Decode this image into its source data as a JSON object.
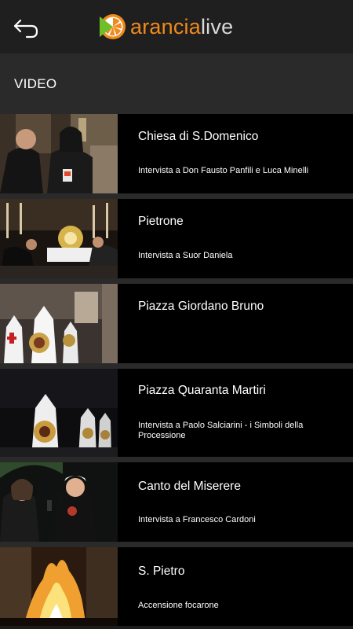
{
  "header": {
    "back_icon": "back-arrow-icon",
    "brand": {
      "part1": "arancia",
      "part2": "live",
      "logo_icon": "orange-slice-play-icon",
      "accent": "#f08a1c"
    }
  },
  "section": {
    "title": "VIDEO"
  },
  "videos": [
    {
      "title": "Chiesa di S.Domenico",
      "subtitle": "Intervista a Don Fausto Panfili e Luca Minelli"
    },
    {
      "title": "Pietrone",
      "subtitle": "Intervista a Suor Daniela"
    },
    {
      "title": "Piazza Giordano Bruno",
      "subtitle": ""
    },
    {
      "title": "Piazza Quaranta Martiri",
      "subtitle": "Intervista a Paolo Salciarini - i Simboli della Processione"
    },
    {
      "title": "Canto del Miserere",
      "subtitle": "Intervista a Francesco Cardoni"
    },
    {
      "title": "S. Pietro",
      "subtitle": "Accensione focarone"
    }
  ]
}
